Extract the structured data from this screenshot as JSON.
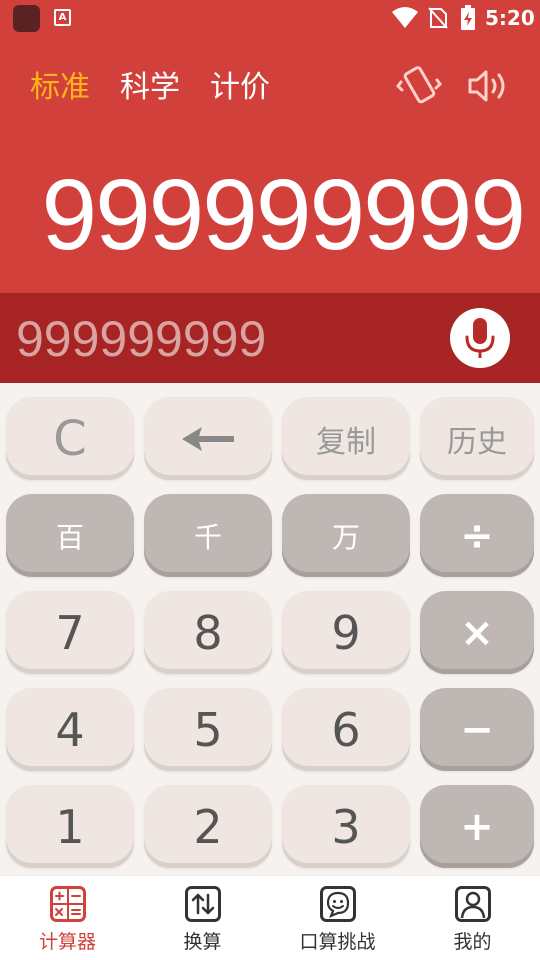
{
  "status_bar": {
    "time": "5:20",
    "icons": [
      "app-icon",
      "a-icon",
      "wifi-icon",
      "no-sim-icon",
      "battery-charging-icon"
    ]
  },
  "tabs": [
    {
      "label": "标准",
      "active": true
    },
    {
      "label": "科学",
      "active": false
    },
    {
      "label": "计价",
      "active": false
    }
  ],
  "header_icons": [
    "vibrate-icon",
    "speaker-icon"
  ],
  "display": {
    "main_value": "999999999",
    "secondary_value": "999999999"
  },
  "keypad": {
    "rows": [
      [
        {
          "label": "C"
        },
        {
          "label": "",
          "icon": "backspace-arrow-icon"
        },
        {
          "label": "复制"
        },
        {
          "label": "历史"
        }
      ],
      [
        {
          "label": "百"
        },
        {
          "label": "千"
        },
        {
          "label": "万"
        },
        {
          "label": "÷"
        }
      ],
      [
        {
          "label": "7"
        },
        {
          "label": "8"
        },
        {
          "label": "9"
        },
        {
          "label": "×"
        }
      ],
      [
        {
          "label": "4"
        },
        {
          "label": "5"
        },
        {
          "label": "6"
        },
        {
          "label": "−"
        }
      ],
      [
        {
          "label": "1"
        },
        {
          "label": "2"
        },
        {
          "label": "3"
        },
        {
          "label": "+"
        }
      ]
    ]
  },
  "bottom_nav": [
    {
      "label": "计算器",
      "icon": "calculator-icon",
      "active": true
    },
    {
      "label": "换算",
      "icon": "convert-icon",
      "active": false
    },
    {
      "label": "口算挑战",
      "icon": "challenge-icon",
      "active": false
    },
    {
      "label": "我的",
      "icon": "profile-icon",
      "active": false
    }
  ],
  "colors": {
    "header_red": "#d2403c",
    "voice_bar_red": "#a62524",
    "active_tab": "#ffb21a",
    "key_light": "#efe6e1",
    "key_dark": "#bfb7b3"
  }
}
